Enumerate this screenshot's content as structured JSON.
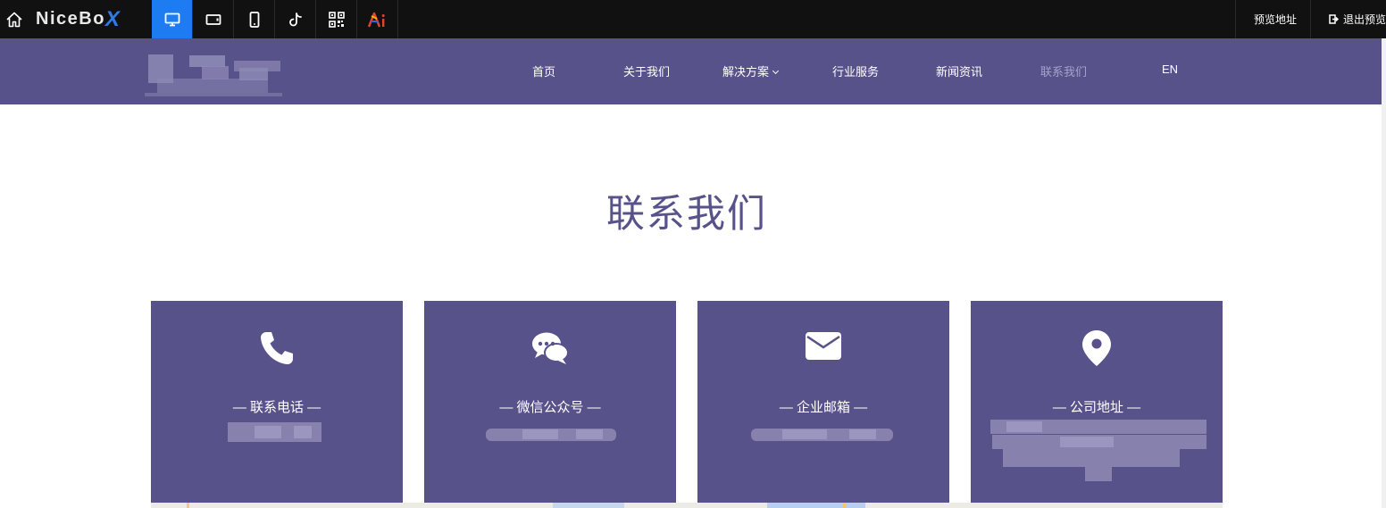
{
  "toolbar": {
    "logo_text": "NiceBo",
    "logo_accent": "X",
    "preview_address": "预览地址",
    "exit_preview": "退出预览",
    "modes": [
      "home-icon",
      "desktop-icon",
      "tablet-icon",
      "mobile-icon",
      "tiktok-icon",
      "qr-code-icon",
      "ai-icon"
    ]
  },
  "nav": {
    "items": [
      {
        "label": "首页"
      },
      {
        "label": "关于我们"
      },
      {
        "label": "解决方案"
      },
      {
        "label": "行业服务"
      },
      {
        "label": "新闻资讯"
      },
      {
        "label": "联系我们"
      },
      {
        "label": "EN"
      }
    ]
  },
  "page": {
    "title": "联系我们"
  },
  "cards": [
    {
      "label": "— 联系电话 —",
      "icon": "phone-icon"
    },
    {
      "label": "— 微信公众号 —",
      "icon": "wechat-icon"
    },
    {
      "label": "— 企业邮箱 —",
      "icon": "mail-icon"
    },
    {
      "label": "— 公司地址 —",
      "icon": "location-pin-icon"
    }
  ],
  "colors": {
    "brand": "#58528b",
    "toolbar_bg": "#111111",
    "active_mode": "#1e7cf2"
  }
}
